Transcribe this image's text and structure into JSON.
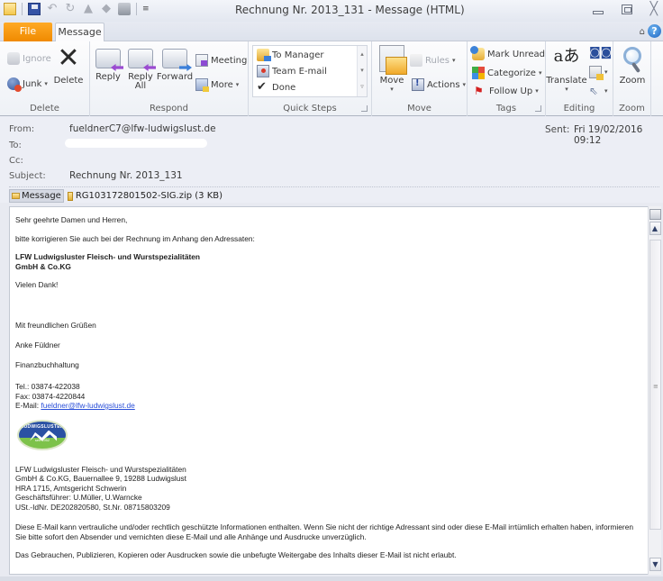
{
  "window": {
    "title": "Rechnung Nr. 2013_131  -  Message (HTML)",
    "controls": {
      "minimize": "minimize",
      "maximize": "maximize",
      "close": "╳"
    }
  },
  "quick_access": {
    "icons": [
      "envelope-icon",
      "save-icon",
      "undo-icon",
      "redo-icon",
      "previous-item-icon",
      "next-item-icon",
      "print-icon",
      "customize-icon"
    ],
    "undo_glyph": "↶",
    "redo_glyph": "↻",
    "up_glyph": "▲",
    "down_glyph": "◆",
    "more_glyph": "≡"
  },
  "tabs": {
    "file": "File",
    "message": "Message",
    "minimize_ribbon_glyph": "⌂",
    "help_glyph": "?"
  },
  "ribbon": {
    "groups": {
      "delete": {
        "label": "Delete",
        "ignore": "Ignore",
        "junk": "Junk",
        "delete": "Delete",
        "delete_glyph": "✕"
      },
      "respond": {
        "label": "Respond",
        "reply": "Reply",
        "reply_all_line1": "Reply",
        "reply_all_line2": "All",
        "forward": "Forward",
        "meeting": "Meeting",
        "more": "More"
      },
      "quick_steps": {
        "label": "Quick Steps",
        "items": [
          "To Manager",
          "Team E-mail",
          "Done"
        ],
        "done_glyph": "✔",
        "scroll_up": "▴",
        "scroll_down": "▾",
        "expand": "▿"
      },
      "move": {
        "label": "Move",
        "move": "Move",
        "rules": "Rules",
        "actions": "Actions"
      },
      "tags": {
        "label": "Tags",
        "mark_unread": "Mark Unread",
        "categorize": "Categorize",
        "follow_up": "Follow Up",
        "follow_up_glyph": "⚑"
      },
      "editing": {
        "label": "Editing",
        "translate": "Translate",
        "translate_glyph": "aあ",
        "find_glyph": "◙◙",
        "select_glyph": "⇖"
      },
      "zoom": {
        "label": "Zoom",
        "zoom": "Zoom"
      }
    },
    "caret": "▾"
  },
  "header": {
    "from_label": "From:",
    "from_value": "fueldnerC7@lfw-ludwigslust.de",
    "to_label": "To:",
    "cc_label": "Cc:",
    "subject_label": "Subject:",
    "subject_value": "Rechnung Nr. 2013_131",
    "sent_label": "Sent:",
    "sent_value": "Fri 19/02/2016 09:12",
    "attachments": {
      "message_tab": "Message",
      "file": "RG103172801502-SIG.zip (3 KB)"
    }
  },
  "body": {
    "greeting": "Sehr geehrte Damen und Herren,",
    "request": "bitte korrigieren Sie auch bei der Rechnung im Anhang den Adressaten:",
    "company_line1": "LFW Ludwigsluster Fleisch- und Wurstspezialitäten",
    "company_line2": "GmbH & Co.KG",
    "thanks": "Vielen Dank!",
    "closing": "Mit freundlichen Grüßen",
    "name": "Anke Füldner",
    "department": "Finanzbuchhaltung",
    "tel": "Tel.: 03874-422038",
    "fax": "Fax: 03874-4220844",
    "email_label": "E-Mail: ",
    "email_link": "fueldner@lfw-ludwigslust.de",
    "logo": {
      "text": "LUDWIGSLUSTER",
      "since": "seit 1952"
    },
    "footer": [
      "LFW Ludwigsluster Fleisch- und Wurstspezialitäten",
      "GmbH & Co.KG, Bauernallee 9, 19288 Ludwigslust",
      "HRA 1715, Amtsgericht Schwerin",
      "Geschäftsführer: U.Müller, U.Warncke",
      "USt.-IdNr. DE202820580, St.Nr. 08715803209"
    ],
    "disclaimer1": "Diese E-Mail kann vertrauliche und/oder rechtlich geschützte Informationen enthalten. Wenn Sie nicht der richtige Adressant sind oder diese E-Mail irrtümlich erhalten haben, informieren Sie bitte sofort den Absender und vernichten diese E-Mail und alle Anhänge und Ausdrucke unverzüglich.",
    "disclaimer2": "Das Gebrauchen, Publizieren, Kopieren oder Ausdrucken sowie die unbefugte Weitergabe des Inhalts dieser E-Mail ist nicht erlaubt."
  },
  "scrollbar": {
    "up": "▲",
    "down": "▼",
    "grip": "≡"
  }
}
